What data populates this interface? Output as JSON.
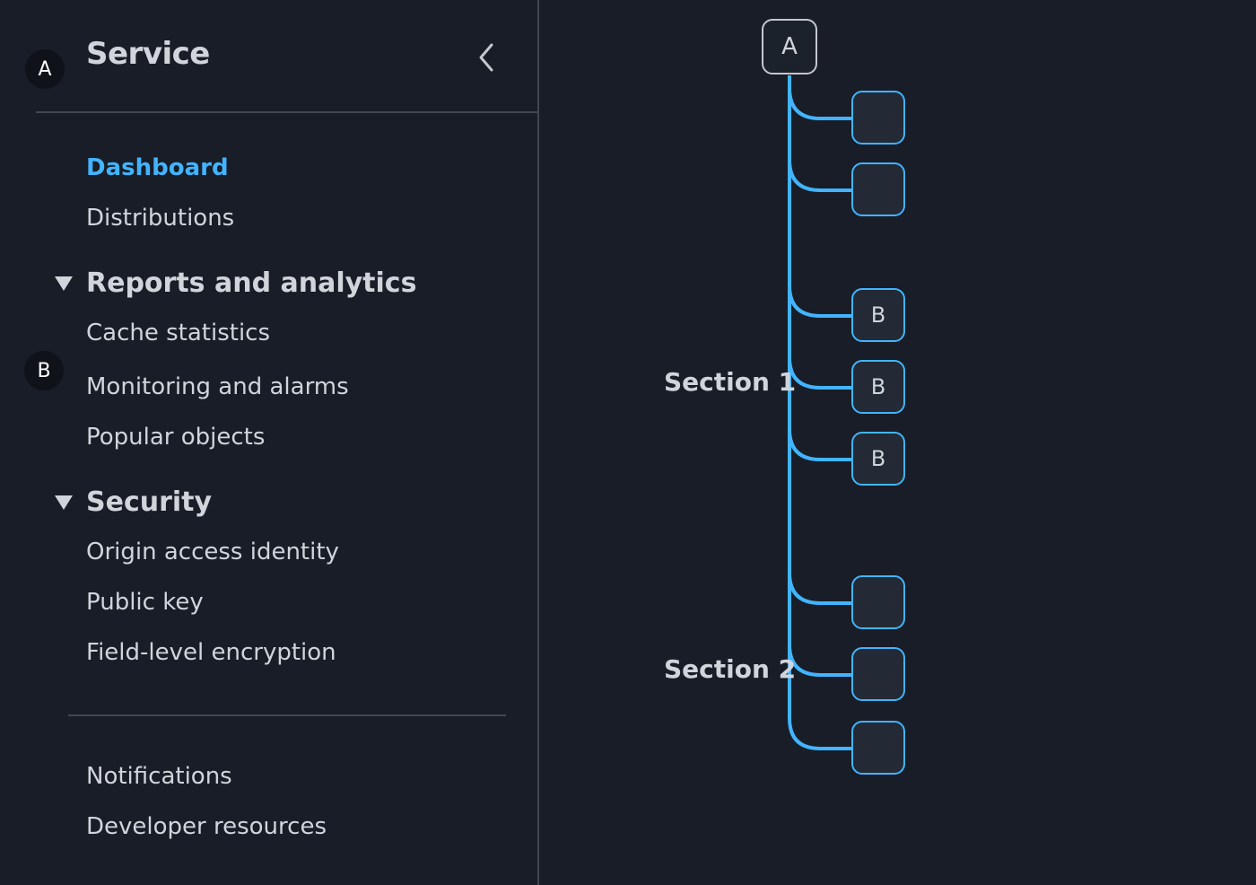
{
  "annotations": {
    "a": "A",
    "b": "B"
  },
  "sidebar": {
    "title": "Service",
    "collapse_icon": "chevron-left-icon",
    "top_items": [
      {
        "label": "Dashboard",
        "active": true
      },
      {
        "label": "Distributions",
        "active": false
      }
    ],
    "sections": [
      {
        "title": "Reports and analytics",
        "expanded": true,
        "items": [
          "Cache statistics",
          "Monitoring and alarms",
          "Popular objects"
        ]
      },
      {
        "title": "Security",
        "expanded": true,
        "items": [
          "Origin access identity",
          "Public key",
          "Field-level encryption"
        ]
      }
    ],
    "bottom_items": [
      "Notifications",
      "Developer resources"
    ]
  },
  "diagram": {
    "root_label": "A",
    "accent_color": "#42b4ff",
    "sections": [
      {
        "label": "Section 1",
        "children": [
          "",
          "",
          "B",
          "B",
          "B"
        ]
      },
      {
        "label": "Section 2",
        "children": [
          "",
          "",
          ""
        ]
      }
    ]
  }
}
